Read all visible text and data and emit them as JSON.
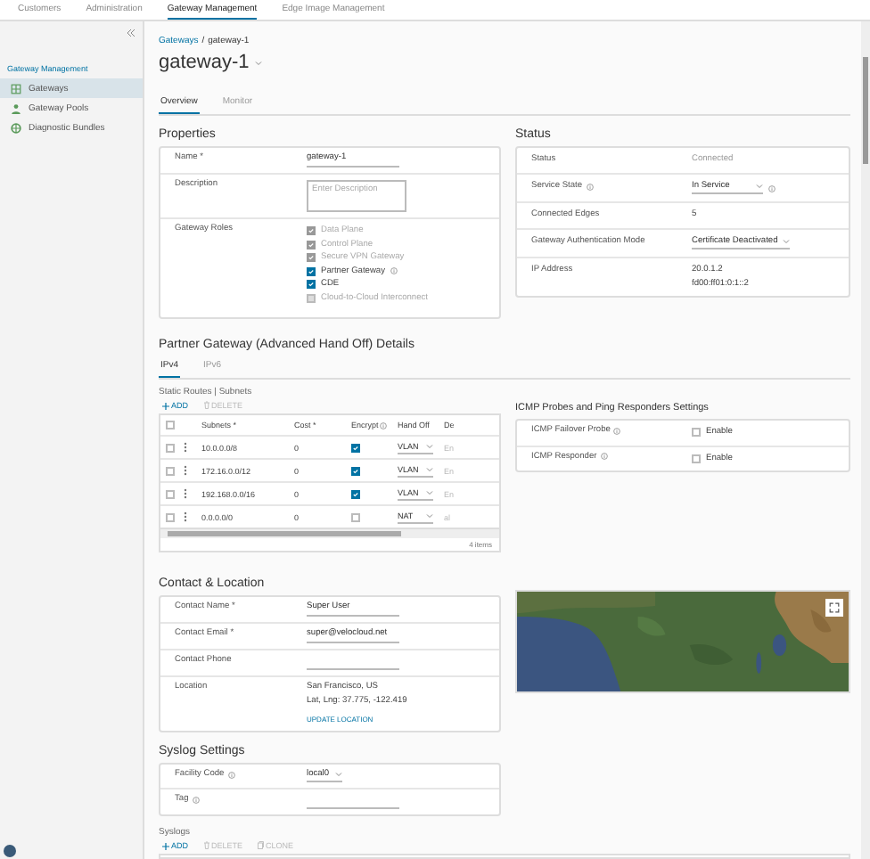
{
  "nav": {
    "tabs": [
      {
        "label": "Customers",
        "selected": false
      },
      {
        "label": "Administration",
        "selected": false
      },
      {
        "label": "Gateway Management",
        "selected": true
      },
      {
        "label": "Edge Image Management",
        "selected": false
      }
    ]
  },
  "sidebar": {
    "heading": "Gateway Management",
    "items": [
      {
        "label": "Gateways",
        "selected": true
      },
      {
        "label": "Gateway Pools",
        "selected": false
      },
      {
        "label": "Diagnostic Bundles",
        "selected": false
      }
    ]
  },
  "breadcrumb": {
    "link": "Gateways",
    "separator": "/",
    "current": "gateway-1"
  },
  "title": "gateway-1",
  "page_tabs": [
    {
      "label": "Overview",
      "selected": true
    },
    {
      "label": "Monitor",
      "selected": false
    }
  ],
  "properties": {
    "title": "Properties",
    "rows": [
      {
        "kind": "input",
        "label": "Name *",
        "value": "gateway-1"
      },
      {
        "kind": "textarea",
        "label": "Description",
        "placeholder": "Enter Description"
      },
      {
        "kind": "checklist",
        "label": "Gateway Roles",
        "items": [
          {
            "label": "Data Plane",
            "checked": true,
            "disabled": true,
            "info": false
          },
          {
            "label": "Control Plane",
            "checked": true,
            "disabled": true,
            "info": false
          },
          {
            "label": "Secure VPN Gateway",
            "checked": true,
            "disabled": true,
            "info": false
          },
          {
            "label": "Partner Gateway",
            "checked": true,
            "disabled": false,
            "info": true
          },
          {
            "label": "CDE",
            "checked": true,
            "disabled": false,
            "info": false
          },
          {
            "label": "Cloud-to-Cloud Interconnect",
            "checked": false,
            "disabled": true,
            "info": false
          }
        ]
      }
    ]
  },
  "status": {
    "title": "Status",
    "rows": [
      {
        "kind": "text",
        "label": "Status",
        "info": false,
        "values": [
          "Connected"
        ],
        "muted": true
      },
      {
        "kind": "select",
        "label": "Service State",
        "info": true,
        "values": [
          "In Service"
        ],
        "value_info": true
      },
      {
        "kind": "text",
        "label": "Connected Edges",
        "info": false,
        "values": [
          "5"
        ],
        "muted": false
      },
      {
        "kind": "select",
        "label": "Gateway Authentication Mode",
        "info": false,
        "values": [
          "Certificate Deactivated"
        ],
        "value_info": false
      },
      {
        "kind": "text",
        "label": "IP Address",
        "info": false,
        "values": [
          "20.0.1.2",
          "fd00:ff01:0:1::2"
        ],
        "muted": false
      }
    ]
  },
  "partner": {
    "title": "Partner Gateway (Advanced Hand Off) Details",
    "tabs": [
      {
        "label": "IPv4",
        "selected": true
      },
      {
        "label": "IPv6",
        "selected": false
      }
    ],
    "routes": {
      "title": "Static Routes | Subnets",
      "actions": [
        {
          "label": "ADD",
          "disabled": false
        },
        {
          "label": "DELETE",
          "disabled": true
        }
      ],
      "columns": [
        {
          "label": "Subnets *",
          "info": false
        },
        {
          "label": "Cost *",
          "info": false
        },
        {
          "label": "Encrypt",
          "info": true
        },
        {
          "label": "Hand Off",
          "info": false
        },
        {
          "label": "De",
          "info": false
        }
      ],
      "select_all": false,
      "rows": [
        {
          "selected": false,
          "subnet": "10.0.0.0/8",
          "cost": "0",
          "encrypt": true,
          "handoff": "VLAN",
          "column_6": "En"
        },
        {
          "selected": false,
          "subnet": "172.16.0.0/12",
          "cost": "0",
          "encrypt": true,
          "handoff": "VLAN",
          "column_6": "En"
        },
        {
          "selected": false,
          "subnet": "192.168.0.0/16",
          "cost": "0",
          "encrypt": true,
          "handoff": "VLAN",
          "column_6": "En"
        },
        {
          "selected": false,
          "subnet": "0.0.0.0/0",
          "cost": "0",
          "encrypt": false,
          "handoff": "NAT",
          "column_6": "al"
        }
      ],
      "footer": "4 items"
    },
    "icmp": {
      "title": "ICMP Probes and Ping Responders Settings",
      "rows": [
        {
          "label": "ICMP Failover Probe",
          "option": "Enable",
          "checked": false
        },
        {
          "label": "ICMP Responder",
          "option": "Enable",
          "checked": false
        }
      ]
    }
  },
  "contact": {
    "title": "Contact & Location",
    "rows": [
      {
        "kind": "input",
        "label": "Contact Name *",
        "value": "Super User"
      },
      {
        "kind": "input",
        "label": "Contact Email *",
        "value": "super@velocloud.net"
      },
      {
        "kind": "input",
        "label": "Contact Phone",
        "value": ""
      },
      {
        "kind": "location",
        "label": "Location",
        "lines": [
          "San Francisco, US",
          "Lat, Lng: 37.775, -122.419"
        ],
        "action": "UPDATE LOCATION"
      }
    ]
  },
  "syslog": {
    "title": "Syslog Settings",
    "rows": [
      {
        "kind": "select",
        "label": "Facility Code",
        "value": "local0"
      },
      {
        "kind": "input",
        "label": "Tag",
        "value": ""
      }
    ]
  },
  "syslogs": {
    "title": "Syslogs",
    "actions": [
      {
        "label": "ADD",
        "disabled": false
      },
      {
        "label": "DELETE",
        "disabled": true
      },
      {
        "label": "CLONE",
        "disabled": true
      }
    ]
  }
}
